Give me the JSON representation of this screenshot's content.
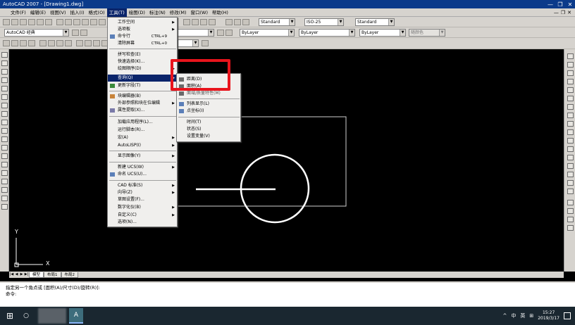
{
  "window": {
    "title": "AutoCAD 2007 - [Drawing1.dwg]",
    "controls": [
      "—",
      "❐",
      "✕"
    ]
  },
  "menubar": {
    "items": [
      "文件(F)",
      "编辑(E)",
      "视图(V)",
      "插入(I)",
      "格式(O)",
      "工具(T)",
      "绘图(D)",
      "标注(N)",
      "修改(M)",
      "窗口(W)",
      "帮助(H)"
    ],
    "active_index": 5
  },
  "toolbar": {
    "workspace": "AutoCAD 经典",
    "text_style": "Standard",
    "dim_style": "ISO-25",
    "table_style": "Standard",
    "layer": "ByLayer",
    "linetype": "ByLayer",
    "lineweight": "ByLayer",
    "plotstyle": "随颜色"
  },
  "tools_menu": {
    "items": [
      {
        "label": "工作空间",
        "sub": true
      },
      {
        "label": "选项板",
        "sub": true
      },
      {
        "label": "命令行",
        "shortcut": "CTRL+9"
      },
      {
        "label": "清除屏幕",
        "shortcut": "CTRL+0"
      },
      {
        "label": "拼写检查(E)"
      },
      {
        "label": "快速选择(K)..."
      },
      {
        "label": "绘图顺序(D)",
        "sub": true
      },
      {
        "label": "查询(Q)",
        "sub": true,
        "highlight": true
      },
      {
        "label": "更新字段(T)"
      },
      {
        "label": "块编辑器(B)"
      },
      {
        "label": "外部参照和块在位编辑",
        "sub": true
      },
      {
        "label": "属性提取(X)..."
      },
      {
        "label": "加载应用程序(L)..."
      },
      {
        "label": "运行脚本(R)..."
      },
      {
        "label": "宏(A)",
        "sub": true
      },
      {
        "label": "AutoLISP(I)",
        "sub": true
      },
      {
        "label": "显示图像(Y)",
        "sub": true
      },
      {
        "label": "新建 UCS(W)",
        "sub": true
      },
      {
        "label": "命名 UCS(U)..."
      },
      {
        "label": "CAD 标准(S)",
        "sub": true
      },
      {
        "label": "向导(Z)",
        "sub": true
      },
      {
        "label": "草图设置(F)..."
      },
      {
        "label": "数字化仪(B)",
        "sub": true
      },
      {
        "label": "自定义(C)",
        "sub": true
      },
      {
        "label": "选项(N)..."
      }
    ]
  },
  "query_submenu": {
    "items": [
      {
        "label": "距离(D)"
      },
      {
        "label": "面积(A)"
      },
      {
        "label": "面域/质量特性(M)"
      },
      {
        "label": "列表显示(L)"
      },
      {
        "label": "点坐标(I)"
      },
      {
        "label": "时间(T)"
      },
      {
        "label": "状态(S)"
      },
      {
        "label": "设置变量(V)"
      }
    ]
  },
  "layout_tabs": [
    "模型",
    "布局1",
    "布局2"
  ],
  "ucs_labels": {
    "x": "X",
    "y": "Y"
  },
  "command": {
    "history": "指定另一个角点或 [面积(A)/尺寸(D)/旋转(R)]:",
    "prompt": "命令:"
  },
  "taskbar": {
    "start_icon": "windows-icon",
    "app_label": "A",
    "tray": [
      "^",
      "中",
      "英",
      "⊞"
    ],
    "time": "15:27",
    "date": "2019/3/17"
  },
  "colors": {
    "titlebar": "#0b3a8a",
    "highlight": "#0a246a",
    "annotation_box": "#e8141c"
  }
}
